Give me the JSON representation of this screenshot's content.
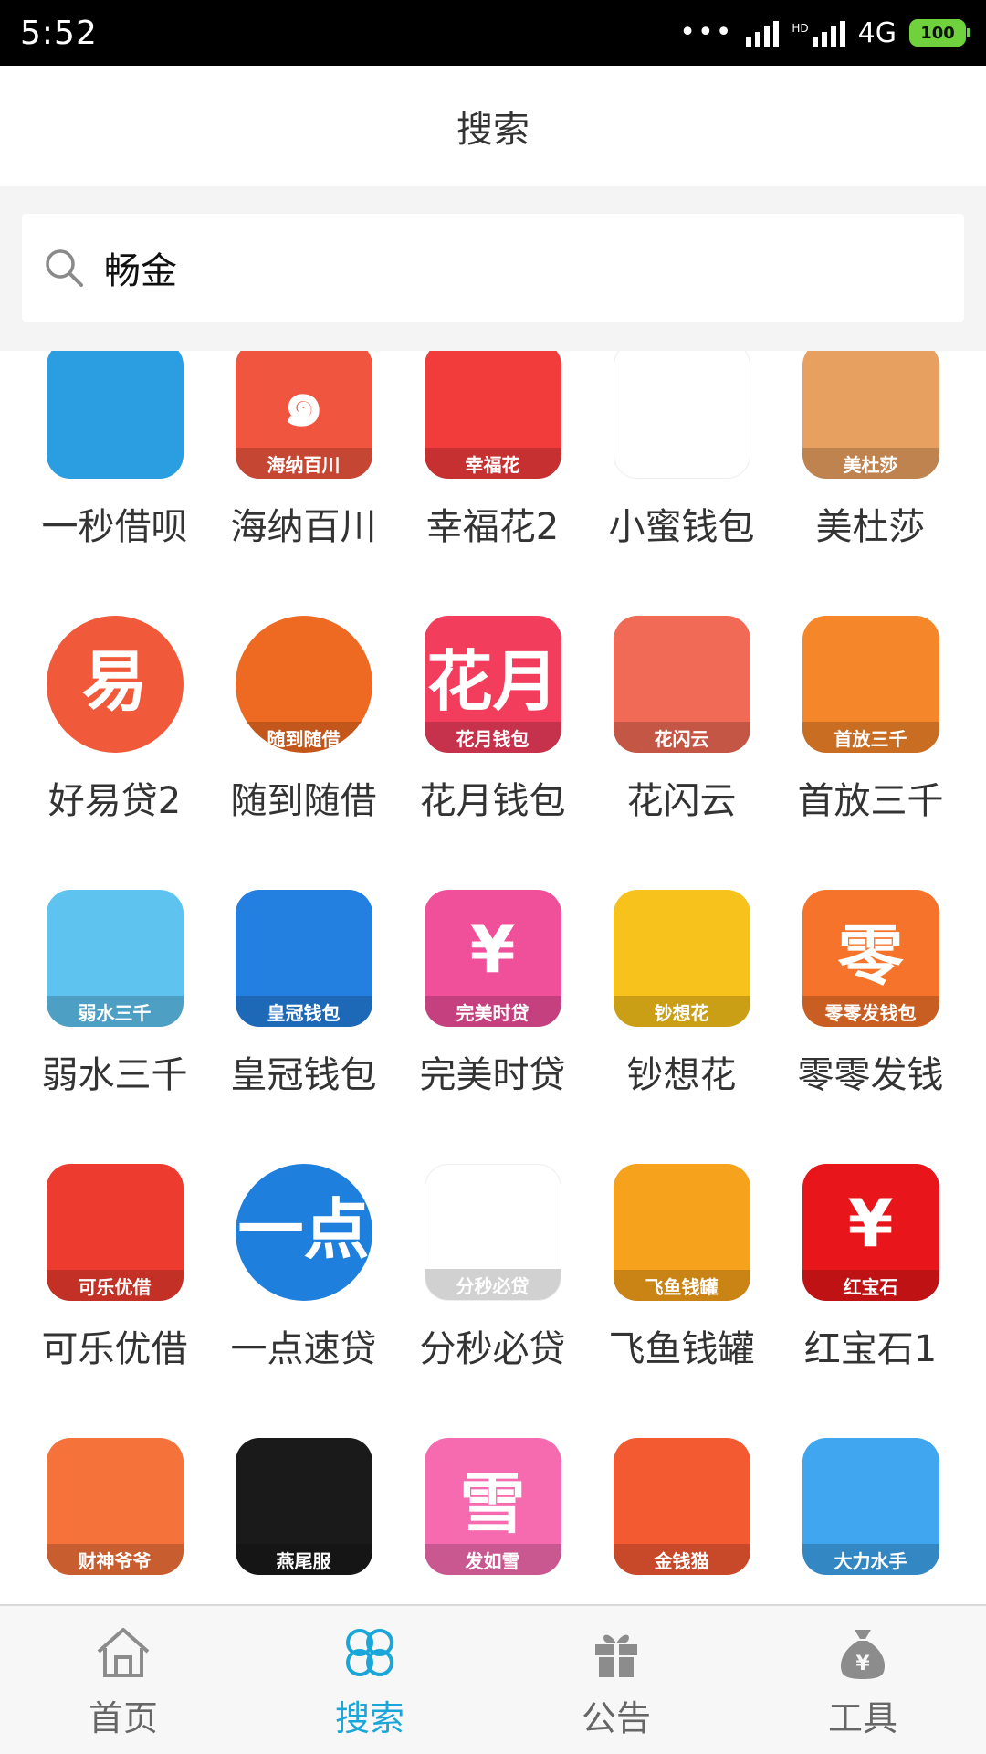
{
  "status_bar": {
    "time": "5:52",
    "network": "4G",
    "hd": "HD",
    "battery": "100"
  },
  "header": {
    "title": "搜索"
  },
  "search": {
    "value": "畅金",
    "placeholder": ""
  },
  "apps": [
    {
      "name": "一秒借呗",
      "icon": "wallet-icon",
      "bg": "#2a9ee0",
      "band": "",
      "glyph": ""
    },
    {
      "name": "海纳百川",
      "icon": "swirl-icon",
      "bg": "#f0563f",
      "band": "海纳百川",
      "glyph": "๑"
    },
    {
      "name": "幸福花2",
      "icon": "gift-icon",
      "bg": "#f23b3b",
      "band": "幸福花",
      "glyph": ""
    },
    {
      "name": "小蜜钱包",
      "icon": "bee-icon",
      "bg": "#ffffff",
      "band": "",
      "glyph": ""
    },
    {
      "name": "美杜莎",
      "icon": "medusa-icon",
      "bg": "#e8a060",
      "band": "美杜莎",
      "glyph": ""
    },
    {
      "name": "好易贷2",
      "icon": "yi-lightning-icon",
      "bg": "#f05a3a",
      "band": "",
      "glyph": "易"
    },
    {
      "name": "随到随借",
      "icon": "mascot-icon",
      "bg": "#ee6a22",
      "band": "随到随借",
      "glyph": ""
    },
    {
      "name": "花月钱包",
      "icon": "huayue-icon",
      "bg": "#f23d5c",
      "band": "花月钱包",
      "glyph": "花月"
    },
    {
      "name": "花闪云",
      "icon": "rocket-icon",
      "bg": "#f06a55",
      "band": "花闪云",
      "glyph": ""
    },
    {
      "name": "首放三千",
      "icon": "hand-icon",
      "bg": "#f5862a",
      "band": "首放三千",
      "glyph": ""
    },
    {
      "name": "弱水三千",
      "icon": "money-bag-icon",
      "bg": "#5ec3ef",
      "band": "弱水三千",
      "glyph": ""
    },
    {
      "name": "皇冠钱包",
      "icon": "crown-icon",
      "bg": "#2480e0",
      "band": "皇冠钱包",
      "glyph": ""
    },
    {
      "name": "完美时贷",
      "icon": "money-bag-hand-icon",
      "bg": "#f04f9a",
      "band": "完美时贷",
      "glyph": "¥"
    },
    {
      "name": "钞想花",
      "icon": "pig-icon",
      "bg": "#f7c21c",
      "band": "钞想花",
      "glyph": ""
    },
    {
      "name": "零零发钱",
      "icon": "ling-icon",
      "bg": "#f5732a",
      "band": "零零发钱包",
      "glyph": "零"
    },
    {
      "name": "可乐优借",
      "icon": "cola-bottle-icon",
      "bg": "#ee3b2f",
      "band": "可乐优借",
      "glyph": ""
    },
    {
      "name": "一点速贷",
      "icon": "yidian-icon",
      "bg": "#1f7fdc",
      "band": "",
      "glyph": "一点"
    },
    {
      "name": "分秒必贷",
      "icon": "clock-coins-icon",
      "bg": "#ffffff",
      "band": "分秒必贷",
      "glyph": ""
    },
    {
      "name": "飞鱼钱罐",
      "icon": "fish-icon",
      "bg": "#f7a21c",
      "band": "飞鱼钱罐",
      "glyph": ""
    },
    {
      "name": "红宝石1",
      "icon": "ruby-icon",
      "bg": "#e8161a",
      "band": "红宝石",
      "glyph": "¥"
    },
    {
      "name": "财神爷爷",
      "icon": "fortune-god-icon",
      "bg": "#f5733a",
      "band": "财神爷爷",
      "glyph": ""
    },
    {
      "name": "燕尾服",
      "icon": "tuxedo-hat-icon",
      "bg": "#1a1a1a",
      "band": "燕尾服",
      "glyph": ""
    },
    {
      "name": "发如雪",
      "icon": "xue-icon",
      "bg": "#f66bb0",
      "band": "发如雪",
      "glyph": "雪"
    },
    {
      "name": "金钱猫",
      "icon": "lucky-cat-icon",
      "bg": "#f45a32",
      "band": "金钱猫",
      "glyph": ""
    },
    {
      "name": "大力水手",
      "icon": "popeye-icon",
      "bg": "#3fa6ef",
      "band": "大力水手",
      "glyph": ""
    }
  ],
  "nav": [
    {
      "label": "首页",
      "icon": "home-icon",
      "active": false
    },
    {
      "label": "搜索",
      "icon": "clover-icon",
      "active": true
    },
    {
      "label": "公告",
      "icon": "gift-icon",
      "active": false
    },
    {
      "label": "工具",
      "icon": "money-bag-icon",
      "active": false
    }
  ],
  "colors": {
    "accent": "#1aa6d8",
    "nav_inactive": "#8c8c8c",
    "text": "#333333"
  }
}
